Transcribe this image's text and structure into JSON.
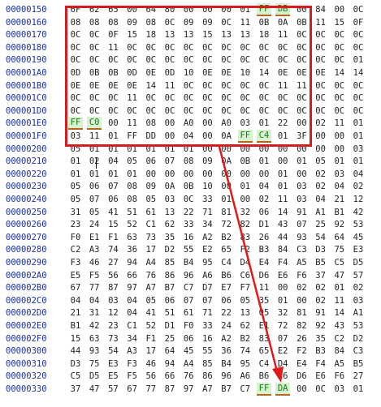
{
  "hex_view": {
    "colors": {
      "address": "#1b2fa8",
      "byte": "#222222",
      "highlight_box": "#d61c1c",
      "arrow": "#e01a1a",
      "marker_fill": "#d7f2cf",
      "marker_underline": "#b5651d"
    },
    "rows": [
      {
        "addr": "00000150",
        "bytes": [
          "6F",
          "62",
          "65",
          "00",
          "64",
          "80",
          "00",
          "00",
          "00",
          "01",
          "FF",
          "DB",
          "00",
          "84",
          "00",
          "0C"
        ]
      },
      {
        "addr": "00000160",
        "bytes": [
          "08",
          "08",
          "08",
          "09",
          "08",
          "0C",
          "09",
          "09",
          "0C",
          "11",
          "0B",
          "0A",
          "0B",
          "11",
          "15",
          "0F"
        ]
      },
      {
        "addr": "00000170",
        "bytes": [
          "0C",
          "0C",
          "0F",
          "15",
          "18",
          "13",
          "13",
          "15",
          "13",
          "13",
          "18",
          "11",
          "0C",
          "0C",
          "0C",
          "0C"
        ]
      },
      {
        "addr": "00000180",
        "bytes": [
          "0C",
          "0C",
          "11",
          "0C",
          "0C",
          "0C",
          "0C",
          "0C",
          "0C",
          "0C",
          "0C",
          "0C",
          "0C",
          "0C",
          "0C",
          "0C"
        ]
      },
      {
        "addr": "00000190",
        "bytes": [
          "0C",
          "0C",
          "0C",
          "0C",
          "0C",
          "0C",
          "0C",
          "0C",
          "0C",
          "0C",
          "0C",
          "0C",
          "0C",
          "0C",
          "0C",
          "01"
        ]
      },
      {
        "addr": "000001A0",
        "bytes": [
          "0D",
          "0B",
          "0B",
          "0D",
          "0E",
          "0D",
          "10",
          "0E",
          "0E",
          "10",
          "14",
          "0E",
          "0E",
          "0E",
          "14",
          "14"
        ]
      },
      {
        "addr": "000001B0",
        "bytes": [
          "0E",
          "0E",
          "0E",
          "0E",
          "14",
          "11",
          "0C",
          "0C",
          "0C",
          "0C",
          "0C",
          "11",
          "11",
          "0C",
          "0C",
          "0C"
        ]
      },
      {
        "addr": "000001C0",
        "bytes": [
          "0C",
          "0C",
          "0C",
          "11",
          "0C",
          "0C",
          "0C",
          "0C",
          "0C",
          "0C",
          "0C",
          "0C",
          "0C",
          "0C",
          "0C",
          "0C"
        ]
      },
      {
        "addr": "000001D0",
        "bytes": [
          "0C",
          "0C",
          "0C",
          "0C",
          "0C",
          "0C",
          "0C",
          "0C",
          "0C",
          "0C",
          "0C",
          "0C",
          "0C",
          "0C",
          "0C",
          "0C"
        ]
      },
      {
        "addr": "000001E0",
        "bytes": [
          "FF",
          "C0",
          "00",
          "11",
          "08",
          "00",
          "A0",
          "00",
          "A0",
          "03",
          "01",
          "22",
          "00",
          "02",
          "11",
          "01"
        ]
      },
      {
        "addr": "000001F0",
        "bytes": [
          "03",
          "11",
          "01",
          "FF",
          "DD",
          "00",
          "04",
          "00",
          "0A",
          "FF",
          "C4",
          "01",
          "3F",
          "00",
          "00",
          "01"
        ]
      },
      {
        "addr": "00000200",
        "bytes": [
          "05",
          "01",
          "01",
          "01",
          "01",
          "01",
          "01",
          "00",
          "00",
          "00",
          "00",
          "00",
          "00",
          "00",
          "00",
          "03"
        ]
      },
      {
        "addr": "00000210",
        "bytes": [
          "01",
          "02",
          "04",
          "05",
          "06",
          "07",
          "08",
          "09",
          "0A",
          "0B",
          "01",
          "00",
          "01",
          "05",
          "01",
          "01"
        ]
      },
      {
        "addr": "00000220",
        "bytes": [
          "01",
          "01",
          "01",
          "01",
          "00",
          "00",
          "00",
          "00",
          "00",
          "00",
          "00",
          "01",
          "00",
          "02",
          "03",
          "04"
        ]
      },
      {
        "addr": "00000230",
        "bytes": [
          "05",
          "06",
          "07",
          "08",
          "09",
          "0A",
          "0B",
          "10",
          "00",
          "01",
          "04",
          "01",
          "03",
          "02",
          "04",
          "02"
        ]
      },
      {
        "addr": "00000240",
        "bytes": [
          "05",
          "07",
          "06",
          "08",
          "05",
          "03",
          "0C",
          "33",
          "01",
          "00",
          "02",
          "11",
          "03",
          "04",
          "21",
          "12"
        ]
      },
      {
        "addr": "00000250",
        "bytes": [
          "31",
          "05",
          "41",
          "51",
          "61",
          "13",
          "22",
          "71",
          "81",
          "32",
          "06",
          "14",
          "91",
          "A1",
          "B1",
          "42"
        ]
      },
      {
        "addr": "00000260",
        "bytes": [
          "23",
          "24",
          "15",
          "52",
          "C1",
          "62",
          "33",
          "34",
          "72",
          "82",
          "D1",
          "43",
          "07",
          "25",
          "92",
          "53"
        ]
      },
      {
        "addr": "00000270",
        "bytes": [
          "F0",
          "E1",
          "F1",
          "63",
          "73",
          "35",
          "16",
          "A2",
          "B2",
          "83",
          "26",
          "44",
          "93",
          "54",
          "64",
          "45"
        ]
      },
      {
        "addr": "00000280",
        "bytes": [
          "C2",
          "A3",
          "74",
          "36",
          "17",
          "D2",
          "55",
          "E2",
          "65",
          "F2",
          "B3",
          "84",
          "C3",
          "D3",
          "75",
          "E3"
        ]
      },
      {
        "addr": "00000290",
        "bytes": [
          "F3",
          "46",
          "27",
          "94",
          "A4",
          "85",
          "B4",
          "95",
          "C4",
          "D4",
          "E4",
          "F4",
          "A5",
          "B5",
          "C5",
          "D5"
        ]
      },
      {
        "addr": "000002A0",
        "bytes": [
          "E5",
          "F5",
          "56",
          "66",
          "76",
          "86",
          "96",
          "A6",
          "B6",
          "C6",
          "D6",
          "E6",
          "F6",
          "37",
          "47",
          "57"
        ]
      },
      {
        "addr": "000002B0",
        "bytes": [
          "67",
          "77",
          "87",
          "97",
          "A7",
          "B7",
          "C7",
          "D7",
          "E7",
          "F7",
          "11",
          "00",
          "02",
          "02",
          "01",
          "02"
        ]
      },
      {
        "addr": "000002C0",
        "bytes": [
          "04",
          "04",
          "03",
          "04",
          "05",
          "06",
          "07",
          "07",
          "06",
          "05",
          "35",
          "01",
          "00",
          "02",
          "11",
          "03"
        ]
      },
      {
        "addr": "000002D0",
        "bytes": [
          "21",
          "31",
          "12",
          "04",
          "41",
          "51",
          "61",
          "71",
          "22",
          "13",
          "05",
          "32",
          "81",
          "91",
          "14",
          "A1"
        ]
      },
      {
        "addr": "000002E0",
        "bytes": [
          "B1",
          "42",
          "23",
          "C1",
          "52",
          "D1",
          "F0",
          "33",
          "24",
          "62",
          "E1",
          "72",
          "82",
          "92",
          "43",
          "53"
        ]
      },
      {
        "addr": "000002F0",
        "bytes": [
          "15",
          "63",
          "73",
          "34",
          "F1",
          "25",
          "06",
          "16",
          "A2",
          "B2",
          "83",
          "07",
          "26",
          "35",
          "C2",
          "D2"
        ]
      },
      {
        "addr": "00000300",
        "bytes": [
          "44",
          "93",
          "54",
          "A3",
          "17",
          "64",
          "45",
          "55",
          "36",
          "74",
          "65",
          "E2",
          "F2",
          "B3",
          "84",
          "C3"
        ]
      },
      {
        "addr": "00000310",
        "bytes": [
          "D3",
          "75",
          "E3",
          "F3",
          "46",
          "94",
          "A4",
          "85",
          "B4",
          "95",
          "C4",
          "D4",
          "E4",
          "F4",
          "A5",
          "B5"
        ]
      },
      {
        "addr": "00000320",
        "bytes": [
          "C5",
          "D5",
          "E5",
          "F5",
          "56",
          "66",
          "76",
          "86",
          "96",
          "A6",
          "B6",
          "C6",
          "D6",
          "E6",
          "F6",
          "27"
        ]
      },
      {
        "addr": "00000330",
        "bytes": [
          "37",
          "47",
          "57",
          "67",
          "77",
          "87",
          "97",
          "A7",
          "B7",
          "C7",
          "FF",
          "DA",
          "00",
          "0C",
          "03",
          "01"
        ]
      }
    ],
    "markers": [
      {
        "row": 0,
        "col": 10
      },
      {
        "row": 0,
        "col": 11
      },
      {
        "row": 9,
        "col": 0
      },
      {
        "row": 9,
        "col": 1
      },
      {
        "row": 10,
        "col": 9
      },
      {
        "row": 10,
        "col": 10
      },
      {
        "row": 30,
        "col": 10
      },
      {
        "row": 30,
        "col": 11
      }
    ]
  }
}
